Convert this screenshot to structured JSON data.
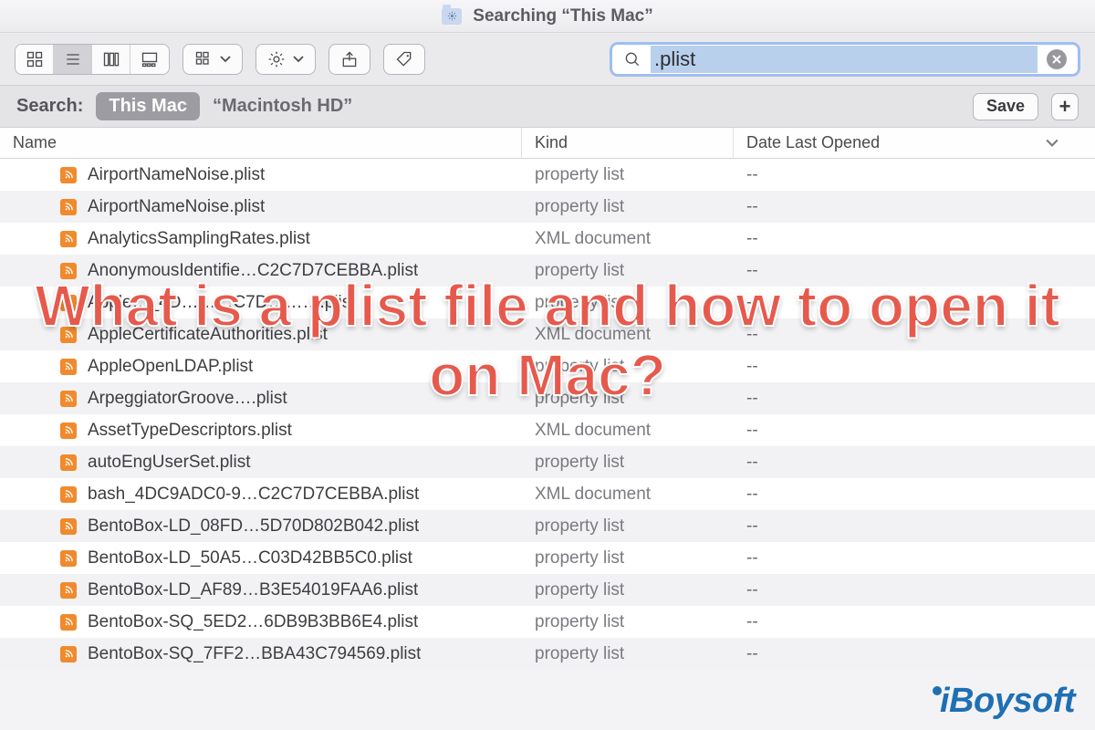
{
  "window": {
    "title": "Searching “This Mac”"
  },
  "search": {
    "query": ".plist"
  },
  "scopebar": {
    "label": "Search:",
    "this_mac": "This Mac",
    "macintosh_hd": "“Macintosh HD”",
    "save_label": "Save",
    "plus_label": "+"
  },
  "columns": {
    "name": "Name",
    "kind": "Kind",
    "date": "Date Last Opened"
  },
  "kinds": {
    "plist": "property list",
    "xml": "XML document"
  },
  "date_placeholder": "--",
  "rows": [
    {
      "name": "AirportNameNoise.plist",
      "kind": "plist"
    },
    {
      "name": "AirportNameNoise.plist",
      "kind": "plist"
    },
    {
      "name": "AnalyticsSamplingRates.plist",
      "kind": "xml"
    },
    {
      "name": "AnonymousIdentifie…C2C7D7CEBBA.plist",
      "kind": "plist"
    },
    {
      "name": "Apple…_4D………C7D……….plist",
      "kind": "plist"
    },
    {
      "name": "AppleCertificateAuthorities.plist",
      "kind": "xml"
    },
    {
      "name": "AppleOpenLDAP.plist",
      "kind": "plist"
    },
    {
      "name": "ArpeggiatorGroove….plist",
      "kind": "plist"
    },
    {
      "name": "AssetTypeDescriptors.plist",
      "kind": "xml"
    },
    {
      "name": "autoEngUserSet.plist",
      "kind": "plist"
    },
    {
      "name": "bash_4DC9ADC0-9…C2C7D7CEBBA.plist",
      "kind": "xml"
    },
    {
      "name": "BentoBox-LD_08FD…5D70D802B042.plist",
      "kind": "plist"
    },
    {
      "name": "BentoBox-LD_50A5…C03D42BB5C0.plist",
      "kind": "plist"
    },
    {
      "name": "BentoBox-LD_AF89…B3E54019FAA6.plist",
      "kind": "plist"
    },
    {
      "name": "BentoBox-SQ_5ED2…6DB9B3BB6E4.plist",
      "kind": "plist"
    },
    {
      "name": "BentoBox-SQ_7FF2…BBA43C794569.plist",
      "kind": "plist"
    }
  ],
  "overlay": {
    "text": "What is a plist file and how to open it on Mac?"
  },
  "watermark": {
    "text": "iBoysoft"
  }
}
